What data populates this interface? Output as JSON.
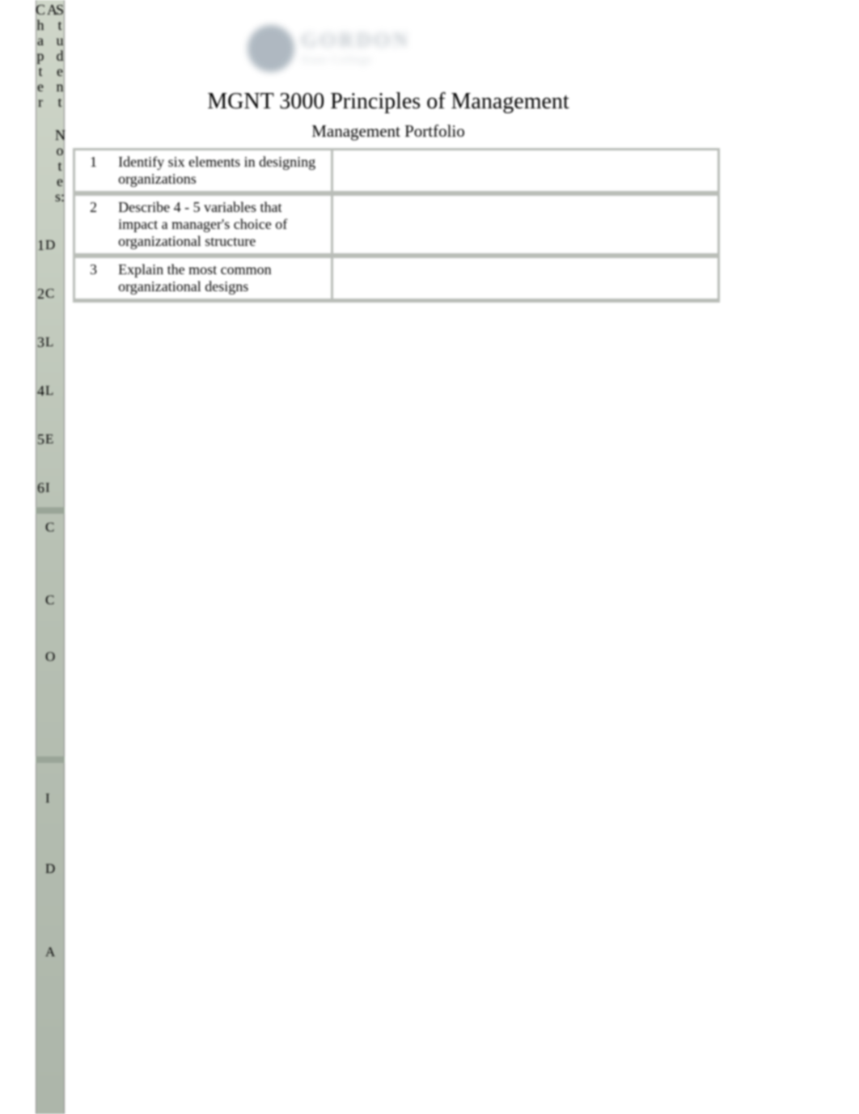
{
  "header": {
    "logo_main": "GORDON",
    "logo_sub": "State College",
    "course_title": "MGNT 3000 Principles of Management",
    "subtitle": "Management Portfolio"
  },
  "left_rail": {
    "label_chapter": "Chapter",
    "label_a": "A",
    "label_student": "Student",
    "label_notes": "Notes:",
    "rows": [
      {
        "n": "1",
        "c": "D"
      },
      {
        "n": "2",
        "c": "C"
      },
      {
        "n": "3",
        "c": "L"
      },
      {
        "n": "4",
        "c": "L"
      },
      {
        "n": "5",
        "c": "E"
      },
      {
        "n": "6",
        "c": "I"
      }
    ],
    "lower_rows": [
      {
        "c": "C"
      },
      {
        "c": "C"
      },
      {
        "c": "O"
      },
      {
        "c": "I"
      },
      {
        "c": "D"
      },
      {
        "c": "A"
      }
    ]
  },
  "objectives": [
    {
      "n": "1",
      "text": "Identify six elements in designing organizations",
      "notes": ""
    },
    {
      "n": "2",
      "text": "Describe 4 - 5 variables that impact a manager's choice of organizational structure",
      "notes": ""
    },
    {
      "n": "3",
      "text": "Explain the most common organizational designs",
      "notes": ""
    }
  ]
}
